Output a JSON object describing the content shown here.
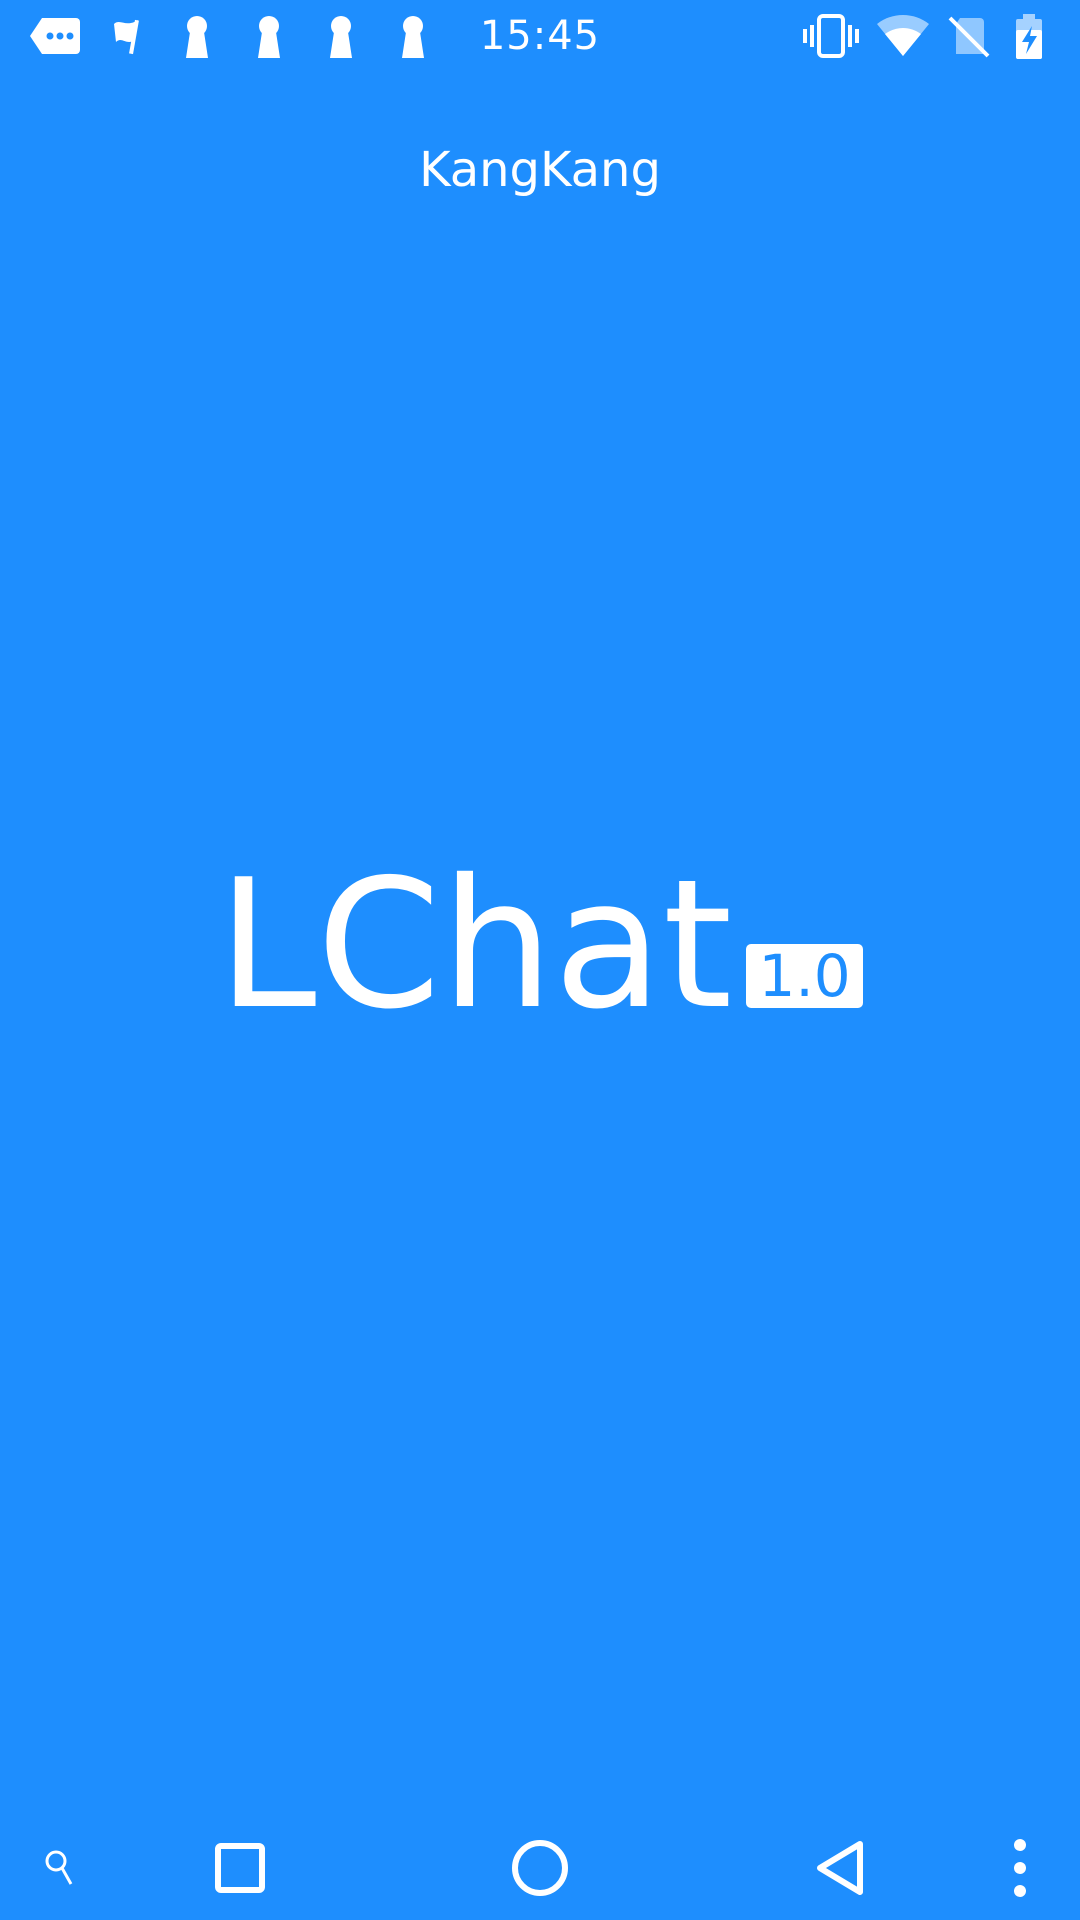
{
  "status_bar": {
    "time": "15:45",
    "left_icons": [
      "message-icon",
      "flag-icon",
      "keyhole-icon",
      "keyhole-icon",
      "keyhole-icon",
      "keyhole-icon"
    ],
    "right_icons": [
      "vibrate-icon",
      "wifi-icon",
      "no-sim-icon",
      "battery-charging-icon"
    ]
  },
  "header": {
    "title": "KangKang"
  },
  "logo": {
    "name": "LChat",
    "version": "1.0"
  },
  "nav_bar": {
    "buttons": [
      "search-icon",
      "recents-icon",
      "home-icon",
      "back-icon",
      "more-icon"
    ]
  },
  "colors": {
    "background": "#1E8EFE",
    "foreground": "#FFFFFF"
  }
}
